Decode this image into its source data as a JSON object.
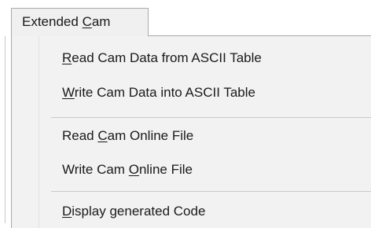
{
  "menu": {
    "title": {
      "before": "Extended ",
      "underlined": "C",
      "after": "am"
    },
    "items": [
      {
        "before": "",
        "underlined": "R",
        "after": "ead Cam Data from ASCII Table"
      },
      {
        "before": "",
        "underlined": "W",
        "after": "rite Cam Data into ASCII Table"
      },
      {
        "before": "Read ",
        "underlined": "C",
        "after": "am Online File"
      },
      {
        "before": "Write Cam ",
        "underlined": "O",
        "after": "nline File"
      },
      {
        "before": "",
        "underlined": "D",
        "after": "isplay generated Code"
      }
    ]
  }
}
